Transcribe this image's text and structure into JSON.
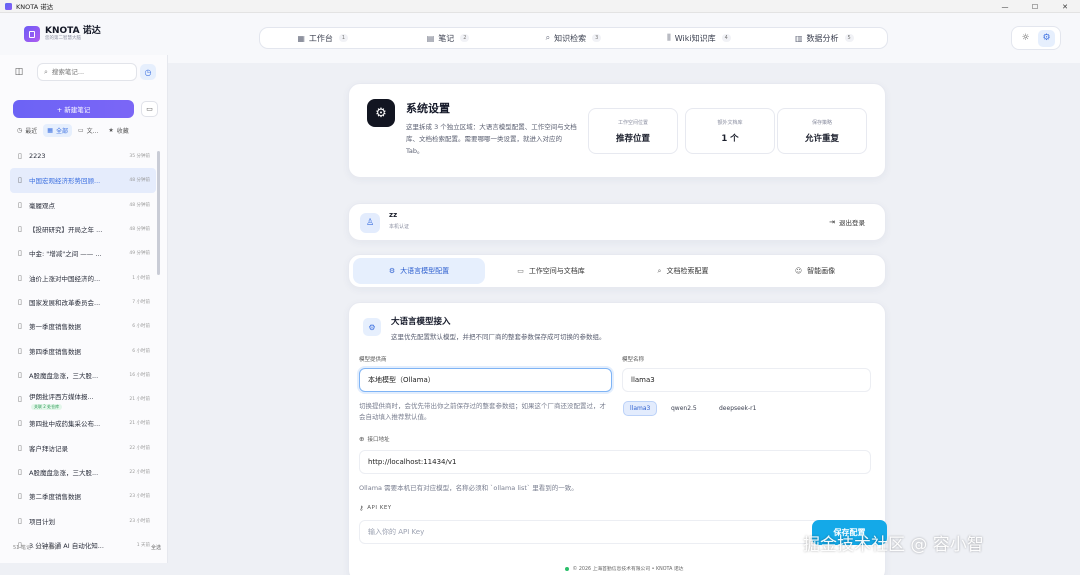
{
  "window": {
    "title": "KNOTA 诺达",
    "controls": [
      "—",
      "☐",
      "✕"
    ]
  },
  "brand": {
    "name": "KNOTA 诺达",
    "subtitle": "您的第二智慧大脑"
  },
  "nav": [
    {
      "label": "工作台",
      "icon": "grid-icon",
      "glyph": "▦",
      "badge": "1"
    },
    {
      "label": "笔记",
      "icon": "note-icon",
      "glyph": "▤",
      "badge": "2"
    },
    {
      "label": "知识检索",
      "icon": "search-icon",
      "glyph": "⌕",
      "badge": "3"
    },
    {
      "label": "Wiki知识库",
      "icon": "library-icon",
      "glyph": "⫼",
      "badge": "4"
    },
    {
      "label": "数据分析",
      "icon": "chart-icon",
      "glyph": "▥",
      "badge": "5"
    }
  ],
  "header_tools": {
    "theme": "☼",
    "settings": "⚙"
  },
  "sidebar": {
    "search_placeholder": "搜索笔记...",
    "new_note": "+ 新建笔记",
    "filters": [
      {
        "label": "最近",
        "glyph": "◷"
      },
      {
        "label": "全部",
        "glyph": "▦"
      },
      {
        "label": "文...",
        "glyph": "▭"
      },
      {
        "label": "收藏",
        "glyph": "★"
      }
    ],
    "notes": [
      {
        "title": "2223",
        "time": "35 分钟前"
      },
      {
        "title": "中国宏观经济形势回顾...",
        "time": "48 分钟前"
      },
      {
        "title": "毫履观点",
        "time": "48 分钟前"
      },
      {
        "title": "【投研研究】开局之年 ...",
        "time": "48 分钟前"
      },
      {
        "title": "中金: \"增减\"之间 —— ...",
        "time": "49 分钟前"
      },
      {
        "title": "油价上涨对中国经济的...",
        "time": "1 小时前"
      },
      {
        "title": "国家发展和改革委员会...",
        "time": "7 小时前"
      },
      {
        "title": "第一季度销售数据",
        "time": "6 小时前"
      },
      {
        "title": "第四季度销售数据",
        "time": "6 小时前"
      },
      {
        "title": "A股魔盘急涨，三大股...",
        "time": "16 小时前"
      },
      {
        "title": "伊朗批评西方媒体报...",
        "time": "21 小时前",
        "tag": "关联 2 处仓库"
      },
      {
        "title": "第四批中成药集采公布...",
        "time": "21 小时前"
      },
      {
        "title": "客户拜访记录",
        "time": "22 小时前"
      },
      {
        "title": "A股魔盘急涨，三大股...",
        "time": "22 小时前"
      },
      {
        "title": "第二季度销售数据",
        "time": "23 小时前"
      },
      {
        "title": "项目计划",
        "time": "23 小时前"
      },
      {
        "title": "3 分钟看通 AI 自动化知...",
        "time": "1 天前"
      }
    ],
    "footer": {
      "count": "51 笔记 · 51 已索引",
      "select": "全选"
    }
  },
  "hero": {
    "title": "系统设置",
    "desc": "这里拆成 3 个独立区域：大语言模型配置、工作空间与文档库、文档检索配置。需要哪哪一类设置，就进入对应的 Tab。",
    "stats": [
      {
        "label": "工作空间位置",
        "value": "推荐位置"
      },
      {
        "label": "额外文档库",
        "value": "1 个"
      },
      {
        "label": "保存策略",
        "value": "允许重复"
      }
    ]
  },
  "user": {
    "name": "zz",
    "status": "本机认证",
    "logout": "退出登录"
  },
  "tabs": [
    {
      "label": "大语言模型配置",
      "glyph": "⚙"
    },
    {
      "label": "工作空间与文档库",
      "glyph": "▭"
    },
    {
      "label": "文档检索配置",
      "glyph": "⌕"
    },
    {
      "label": "智能画像",
      "glyph": "☺"
    }
  ],
  "llm": {
    "title": "大语言模型接入",
    "desc": "这里优先配置默认模型，并把不同厂商的整套参数保存成可切换的参数组。",
    "provider_label": "模型提供商",
    "provider_value": "本地模型（Ollama）",
    "provider_hint": "切换提供商时，会优先带出你之前保存过的整套参数组；如果这个厂商还没配置过，才会自动填入推荐默认值。",
    "model_label": "模型名称",
    "model_value": "llama3",
    "model_chips": [
      "llama3",
      "qwen2.5",
      "deepseek-r1"
    ],
    "endpoint_label": "接口地址",
    "endpoint_value": "http://localhost:11434/v1",
    "endpoint_hint": "Ollama 需要本机已有对应模型，名称必须和 `ollama list` 里看到的一致。",
    "api_key_label": "API KEY",
    "api_key_placeholder": "输入你的 API Key",
    "save_label": "保存配置"
  },
  "watermark": "掘金技术社区 @ 容小智",
  "footer": "© 2026 上海首勤信息技术有限公司 • KNOTA 诺达"
}
